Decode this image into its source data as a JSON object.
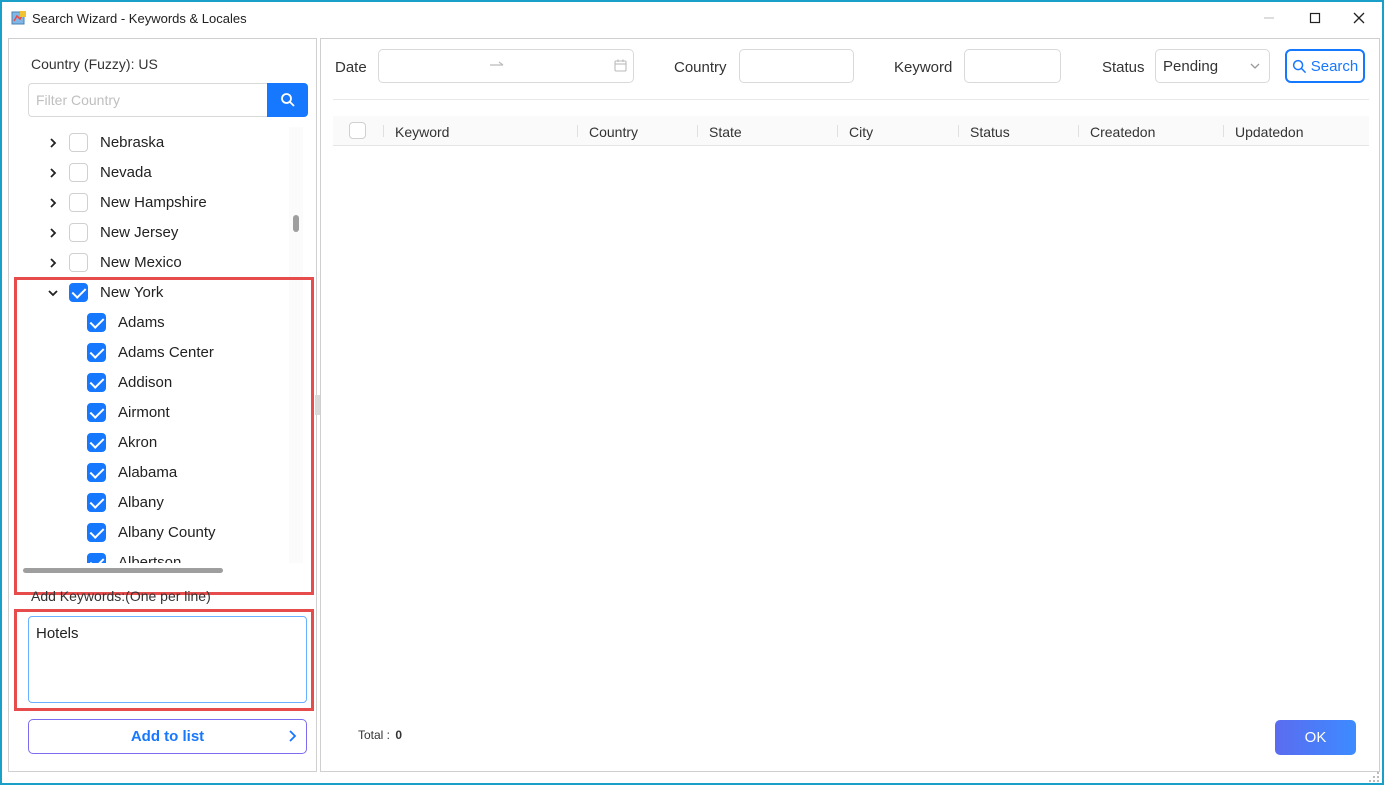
{
  "window": {
    "title": "Search Wizard - Keywords & Locales"
  },
  "left": {
    "country_label": "Country (Fuzzy): US",
    "filter_placeholder": "Filter Country",
    "tree": [
      {
        "label": "Nebraska",
        "level": 0,
        "expanded": false,
        "checked": false
      },
      {
        "label": "Nevada",
        "level": 0,
        "expanded": false,
        "checked": false
      },
      {
        "label": "New Hampshire",
        "level": 0,
        "expanded": false,
        "checked": false
      },
      {
        "label": "New Jersey",
        "level": 0,
        "expanded": false,
        "checked": false
      },
      {
        "label": "New Mexico",
        "level": 0,
        "expanded": false,
        "checked": false
      },
      {
        "label": "New York",
        "level": 0,
        "expanded": true,
        "checked": true
      },
      {
        "label": "Adams",
        "level": 1,
        "checked": true
      },
      {
        "label": "Adams Center",
        "level": 1,
        "checked": true
      },
      {
        "label": "Addison",
        "level": 1,
        "checked": true
      },
      {
        "label": "Airmont",
        "level": 1,
        "checked": true
      },
      {
        "label": "Akron",
        "level": 1,
        "checked": true
      },
      {
        "label": "Alabama",
        "level": 1,
        "checked": true
      },
      {
        "label": "Albany",
        "level": 1,
        "checked": true
      },
      {
        "label": "Albany County",
        "level": 1,
        "checked": true
      },
      {
        "label": "Albertson",
        "level": 1,
        "checked": true
      }
    ],
    "keywords_label": "Add Keywords:(One per line)",
    "keywords_value": "Hotels",
    "add_button_label": "Add to list"
  },
  "filters": {
    "date_label": "Date",
    "country_label": "Country",
    "keyword_label": "Keyword",
    "status_label": "Status",
    "status_value": "Pending",
    "search_label": "Search"
  },
  "table": {
    "columns": [
      "Keyword",
      "Country",
      "State",
      "City",
      "Status",
      "Createdon",
      "Updatedon"
    ],
    "rows": []
  },
  "footer": {
    "total_label": "Total :",
    "total_value": "0",
    "ok_label": "OK"
  },
  "colors": {
    "accent": "#1677ff",
    "highlight": "#e74c4c",
    "window_border": "#1aa0c8"
  }
}
